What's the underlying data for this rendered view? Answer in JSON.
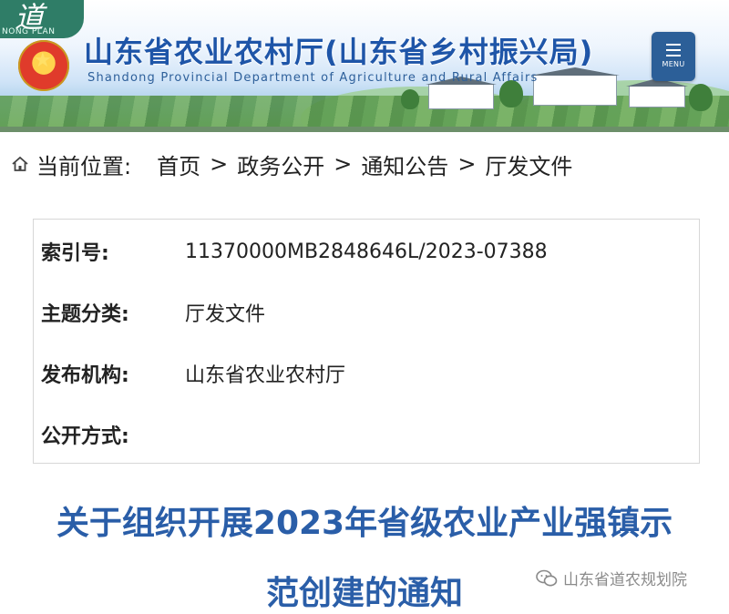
{
  "header": {
    "corner_logo_glyph": "道",
    "corner_logo_text": "NONG PLAN",
    "title": "山东省农业农村厅(山东省乡村振兴局)",
    "subtitle": "Shandong Provincial Department of Agriculture and Rural Affairs",
    "menu_label": "MENU"
  },
  "breadcrumb": {
    "prefix": "当前位置:",
    "items": [
      "首页",
      "政务公开",
      "通知公告",
      "厅发文件"
    ],
    "separator": ">"
  },
  "metadata": {
    "rows": [
      {
        "label": "索引号:",
        "value": "11370000MB2848646L/2023-07388"
      },
      {
        "label": "主题分类:",
        "value": "厅发文件"
      },
      {
        "label": "发布机构:",
        "value": "山东省农业农村厅"
      },
      {
        "label": "公开方式:",
        "value": ""
      }
    ]
  },
  "article": {
    "title_line1": "关于组织开展2023年省级农业产业强镇示",
    "title_line2": "范创建的通知"
  },
  "watermark": {
    "text": "山东省道农规划院",
    "icon": "wechat-icon"
  },
  "colors": {
    "title_blue": "#2a5ea8",
    "header_blue": "#1e55a8",
    "menu_bg": "#2c5f98",
    "logo_green": "#2f7d67"
  }
}
